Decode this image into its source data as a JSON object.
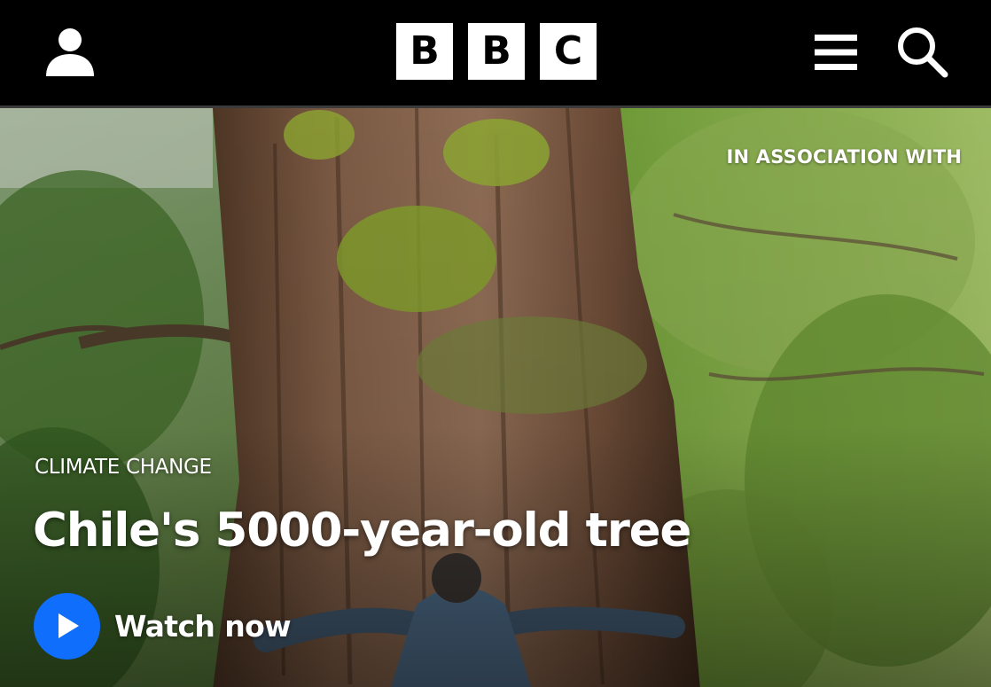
{
  "header": {
    "logo_letters": [
      "B",
      "B",
      "C"
    ],
    "account_icon": "user-icon",
    "menu_icon": "hamburger-menu-icon",
    "search_icon": "search-icon",
    "background": "#000000"
  },
  "hero": {
    "sponsor_label": "IN ASSOCIATION WITH",
    "category": "CLIMATE CHANGE",
    "headline": "Chile's 5000-year-old tree",
    "cta_label": "Watch now",
    "cta_icon": "play-icon",
    "accent_color": "#0f6efb"
  }
}
